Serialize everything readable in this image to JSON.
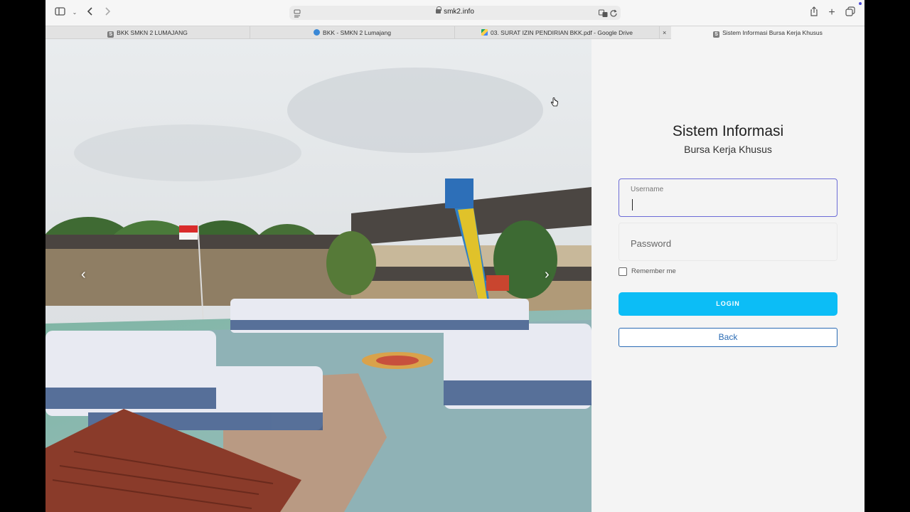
{
  "browser": {
    "url": "smk2.info",
    "tabs": [
      {
        "label": "BKK SMKN 2 LUMAJANG",
        "favicon": "S"
      },
      {
        "label": "BKK - SMKN 2 Lumajang",
        "favicon": "person"
      },
      {
        "label": "03. SURAT IZIN PENDIRIAN BKK.pdf - Google Drive",
        "favicon": "google-drive"
      },
      {
        "label": "Sistem Informasi Bursa Kerja Khusus",
        "favicon": "S"
      }
    ],
    "close_tab_glyph": "×"
  },
  "hero": {
    "prev_glyph": "‹",
    "next_glyph": "›"
  },
  "login": {
    "title": "Sistem Informasi",
    "subtitle": "Bursa Kerja Khusus",
    "username_label": "Username",
    "username_value": "",
    "password_placeholder": "Password",
    "remember_label": "Remember me",
    "login_label": "LOGIN",
    "back_label": "Back"
  },
  "colors": {
    "login_button": "#0cbdf6",
    "back_border": "#2a6bb4",
    "username_focus": "#6b6bd6"
  }
}
